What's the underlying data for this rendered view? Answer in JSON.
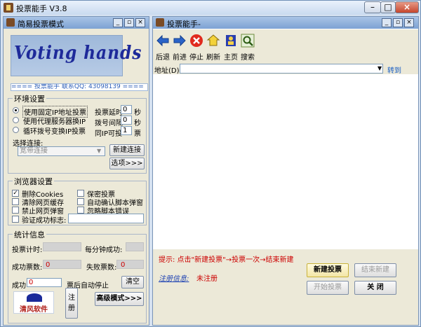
{
  "app": {
    "title": "投票能手 V3.8"
  },
  "left": {
    "title": "简易投票模式",
    "logo_text": "Voting hands",
    "contact": "==== 投票能手 联系QQ: 43098139 ====",
    "env": {
      "legend": "环境设置",
      "options": [
        "使用固定IP地址投票",
        "使用代理服务器换IP",
        "循环拨号变换IP投票"
      ],
      "vote_delay_label": "投票延时",
      "vote_delay_value": "0",
      "dial_interval_label": "拨号间隔",
      "dial_interval_value": "0",
      "same_ip_label": "同IP可投",
      "same_ip_value": "1",
      "unit_sec": "秒",
      "unit_sec2": "秒",
      "unit_votes": "票",
      "select_label": "选择连接:",
      "connection_value": "宽带连接",
      "new_connection": "新建连接",
      "options_btn": "选项>>>"
    },
    "browser": {
      "legend": "浏览器设置",
      "delete_cookies": "删除Cookies",
      "keep_vote": "保密投票",
      "clear_cache": "清除网页缓存",
      "auto_confirm": "自动确认脚本弹窗",
      "block_popup": "禁止网页弹窗",
      "ignore_errors": "忽略脚本错误",
      "verify_label": "验证成功标志:"
    },
    "stats": {
      "legend": "统计信息",
      "vote_timer": "投票计时:",
      "per_minute": "每分钟成功:",
      "success_label": "成功票数:",
      "success_value": "0",
      "fail_label": "失败票数:",
      "fail_value": "0",
      "success_stop_label": "成功",
      "success_stop_value": "0",
      "auto_stop": "票后自动停止",
      "clear": "清空",
      "brand": "清风软件",
      "register": "注册",
      "advanced": "高级模式>>>"
    }
  },
  "right": {
    "title": "投票能手-",
    "toolbar": [
      "后退",
      "前进",
      "停止",
      "刷新",
      "主页",
      "搜索"
    ],
    "address_label": "地址(D)",
    "go": "转到",
    "hint": "提示: 点击\"新建投票\"→投票一次→结束新建",
    "reg_label": "注册信息:",
    "reg_value": "未注册",
    "new_vote": "新建投票",
    "end_new": "结束新建",
    "start_vote": "开始投票",
    "close": "关 闭"
  },
  "colors": {
    "accent_blue": "#2e5fb8",
    "hint_red": "#cc0000",
    "reg_blue": "#1a3fb2"
  }
}
